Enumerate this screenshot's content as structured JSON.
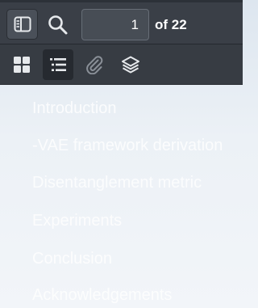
{
  "toolbar": {
    "page_input_value": "1",
    "page_of_label": "of 22"
  },
  "outline": {
    "items": [
      {
        "label": "Introduction"
      },
      {
        "label": "-VAE framework derivation"
      },
      {
        "label": "Disentanglement metric"
      },
      {
        "label": "Experiments"
      },
      {
        "label": "Conclusion"
      },
      {
        "label": "Acknowledgements"
      }
    ]
  },
  "colors": {
    "toolbar_bg": "#3a3f47",
    "tabbar_bg": "#373c43",
    "active_tab_bg": "#262a30",
    "icon_color": "#e6e9ec",
    "inactive_icon_color": "#8a9098",
    "sidebar_bg_top": "#dde6ef"
  },
  "icons": {
    "sidebar_toggle": "sidebar-toggle-icon",
    "search": "search-icon",
    "thumbnails": "thumbnails-grid-icon",
    "outline": "outline-list-icon",
    "attachments": "paperclip-icon",
    "layers": "layers-icon"
  }
}
